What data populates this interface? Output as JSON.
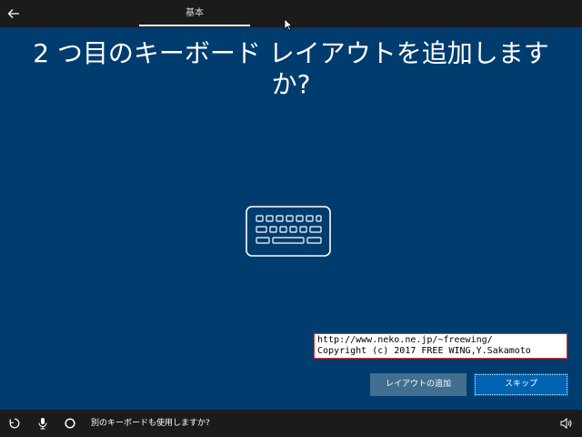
{
  "header": {
    "tab_label": "基本"
  },
  "main": {
    "title_line1": "2 つ目のキーボード レイアウトを追加します",
    "title_line2": "か?"
  },
  "watermark": {
    "line1": "http://www.neko.ne.jp/~freewing/",
    "line2": "Copyright (c) 2017 FREE WING,Y.Sakamoto"
  },
  "buttons": {
    "add_layout": "レイアウトの追加",
    "skip": "スキップ"
  },
  "taskbar": {
    "prompt": "別のキーボードも使用しますか?"
  },
  "colors": {
    "background": "#003c6e",
    "topbar": "#1b1b1b",
    "primary_button": "#0063b1",
    "secondary_button": "#426e8f"
  },
  "icons": [
    "back-arrow-icon",
    "keyboard-icon",
    "ease-of-access-icon",
    "microphone-icon",
    "cortana-icon",
    "volume-icon",
    "mouse-cursor-icon"
  ]
}
